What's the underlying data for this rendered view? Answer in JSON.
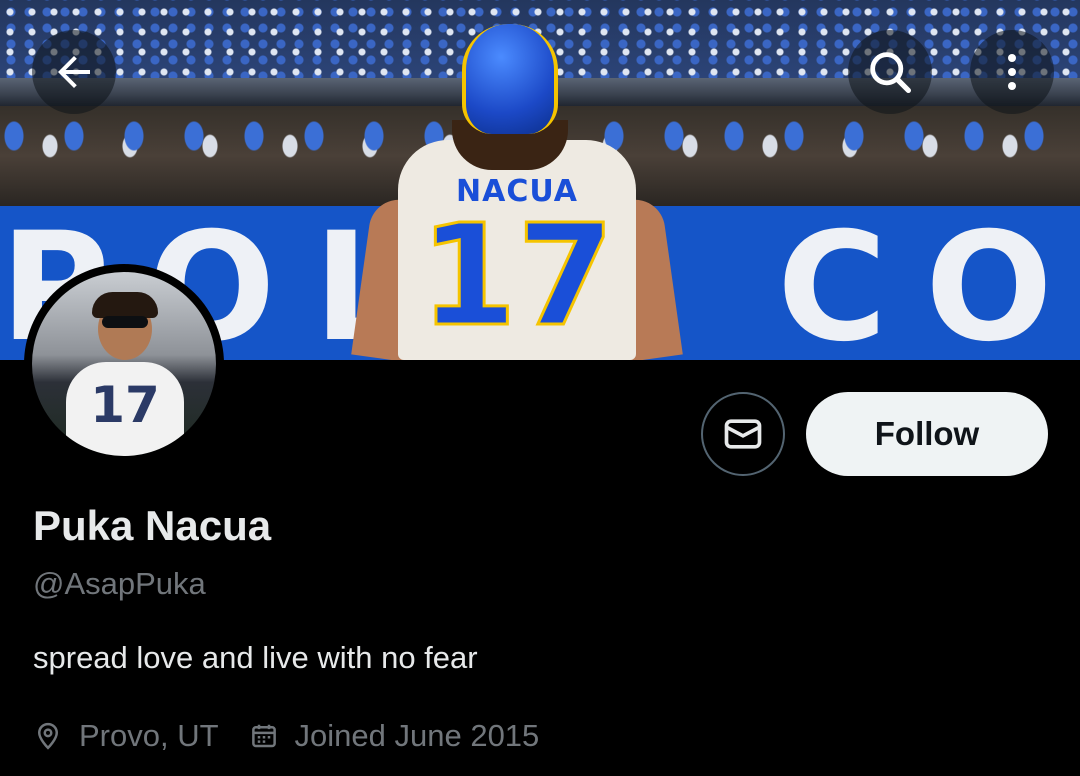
{
  "header": {
    "back_icon": "arrow-left-icon",
    "search_icon": "search-icon",
    "more_icon": "more-vertical-icon"
  },
  "banner": {
    "description_colors": {
      "wall": "#1555c8",
      "jersey_number": "#1a4fd8",
      "helmet_trim": "#f5c400"
    },
    "jersey_name": "NACUA",
    "jersey_number": "17",
    "wall_text": "POLIS COLTS"
  },
  "avatar": {
    "jersey_number": "17"
  },
  "actions": {
    "message_icon": "mail-icon",
    "follow_label": "Follow"
  },
  "profile": {
    "display_name": "Puka Nacua",
    "handle": "@AsapPuka",
    "bio": "spread love and live with no fear",
    "location_icon": "location-pin-icon",
    "location": "Provo, UT",
    "joined_icon": "calendar-icon",
    "joined": "Joined June 2015"
  },
  "colors": {
    "background": "#000000",
    "primary_text": "#e7e9ea",
    "secondary_text": "#71767b",
    "follow_button_bg": "#eff3f4",
    "follow_button_text": "#0f1419"
  }
}
